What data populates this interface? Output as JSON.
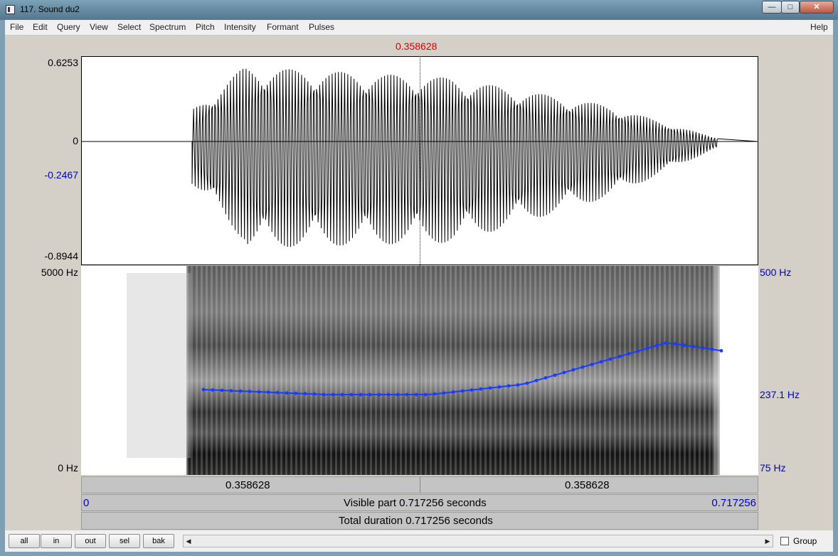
{
  "window": {
    "title": "117. Sound du2",
    "minimize": "—",
    "maximize": "□",
    "close": "✕"
  },
  "menu": [
    "File",
    "Edit",
    "Query",
    "View",
    "Select",
    "Spectrum",
    "Pitch",
    "Intensity",
    "Formant",
    "Pulses"
  ],
  "help_label": "Help",
  "cursor_time": "0.358628",
  "waveform": {
    "max_label": "0.6253",
    "zero_label": "0",
    "cursor_value_label": "-0.2467",
    "min_label": "-0.8944"
  },
  "spectrogram": {
    "freq_max_label": "5000 Hz",
    "freq_min_label": "0 Hz",
    "pitch_max_label": "500 Hz",
    "pitch_value_label": "237.1 Hz",
    "pitch_min_label": "75 Hz"
  },
  "time_bar": {
    "left_segment": "0.358628",
    "right_segment": "0.358628"
  },
  "visible_bar": {
    "start": "0",
    "text": "Visible part 0.717256 seconds",
    "end": "0.717256"
  },
  "total_bar": {
    "text": "Total duration 0.717256 seconds"
  },
  "buttons": [
    "all",
    "in",
    "out",
    "sel",
    "bak"
  ],
  "scroll_left_icon": "◀",
  "scroll_right_icon": "▶",
  "group_label": "Group",
  "colors": {
    "pitch_track": "#1a3cff",
    "cursor": "#d00000",
    "axis_blue": "#0000c8"
  }
}
